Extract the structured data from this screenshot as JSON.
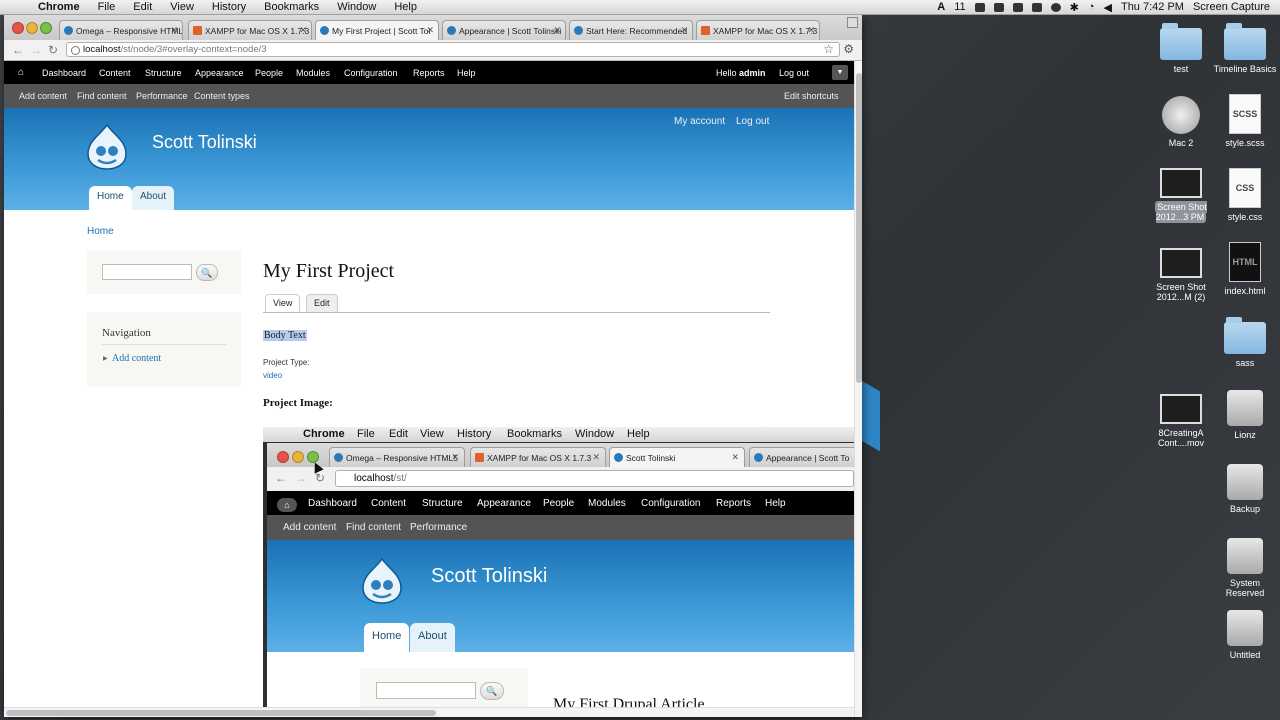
{
  "menubar": {
    "app": "Chrome",
    "items": [
      "File",
      "Edit",
      "View",
      "History",
      "Bookmarks",
      "Window",
      "Help"
    ],
    "notification_count": "11",
    "clock": "Thu 7:42 PM",
    "right_app": "Screen Capture"
  },
  "browser": {
    "tabs": [
      {
        "title": "Omega – Responsive HTML5",
        "fav": "drupal"
      },
      {
        "title": "XAMPP for Mac OS X 1.7.3",
        "fav": "xampp"
      },
      {
        "title": "My First Project | Scott Tol",
        "fav": "drupal"
      },
      {
        "title": "Appearance | Scott Tolinski",
        "fav": "drupal"
      },
      {
        "title": "Start Here: Recommended",
        "fav": "drupal"
      },
      {
        "title": "XAMPP for Mac OS X 1.7.3",
        "fav": "xampp"
      }
    ],
    "url_host": "localhost",
    "url_path": "/st/node/3#overlay-context=node/3"
  },
  "admin": {
    "items": [
      "Dashboard",
      "Content",
      "Structure",
      "Appearance",
      "People",
      "Modules",
      "Configuration",
      "Reports",
      "Help"
    ],
    "hello": "Hello",
    "user": "admin",
    "logout": "Log out"
  },
  "shortcuts": {
    "items": [
      "Add content",
      "Find content",
      "Performance",
      "Content types"
    ],
    "edit": "Edit shortcuts"
  },
  "site": {
    "name": "Scott Tolinski",
    "my_account": "My account",
    "logout": "Log out",
    "tabs": [
      "Home",
      "About"
    ]
  },
  "page": {
    "breadcrumb": "Home",
    "nav_title": "Navigation",
    "nav_link": "Add content",
    "title": "My First Project",
    "view_tab": "View",
    "edit_tab": "Edit",
    "body": "Body Text",
    "project_type_label": "Project Type:",
    "project_type_value": "video",
    "project_image_label": "Project Image:"
  },
  "nested": {
    "menubar_app": "Chrome",
    "menubar_items": [
      "File",
      "Edit",
      "View",
      "History",
      "Bookmarks",
      "Window",
      "Help"
    ],
    "tabs": [
      {
        "title": "Omega – Responsive HTML5",
        "fav": "drupal"
      },
      {
        "title": "XAMPP for Mac OS X 1.7.3",
        "fav": "xampp"
      },
      {
        "title": "Scott Tolinski",
        "fav": "drupal"
      },
      {
        "title": "Appearance | Scott To",
        "fav": "drupal"
      }
    ],
    "url_host": "localhost",
    "url_path": "/st/",
    "admin_items": [
      "Dashboard",
      "Content",
      "Structure",
      "Appearance",
      "People",
      "Modules",
      "Configuration",
      "Reports",
      "Help"
    ],
    "shortcut_items": [
      "Add content",
      "Find content",
      "Performance"
    ],
    "site_name": "Scott Tolinski",
    "site_tabs": [
      "Home",
      "About"
    ],
    "article_title": "My First Drupal Article"
  },
  "desktop": {
    "icons": [
      {
        "label": "test",
        "kind": "folder"
      },
      {
        "label": "Timeline Basics",
        "kind": "folder"
      },
      {
        "label": "Mac 2",
        "kind": "hd"
      },
      {
        "label": "style.scss",
        "kind": "doc",
        "badge": "SCSS"
      },
      {
        "label": "Screen Shot 2012...3 PM",
        "kind": "shot"
      },
      {
        "label": "style.css",
        "kind": "doc",
        "badge": "CSS"
      },
      {
        "label": "Screen Shot 2012...M (2)",
        "kind": "shot"
      },
      {
        "label": "index.html",
        "kind": "doc-dark",
        "badge": "HTML"
      },
      {
        "label": "sass",
        "kind": "folder"
      },
      {
        "label": "8CreatingA Cont....mov",
        "kind": "shot"
      },
      {
        "label": "Lionz",
        "kind": "drive"
      },
      {
        "label": "Backup",
        "kind": "drive"
      },
      {
        "label": "System Reserved",
        "kind": "drive"
      },
      {
        "label": "Untitled",
        "kind": "drive"
      }
    ]
  }
}
